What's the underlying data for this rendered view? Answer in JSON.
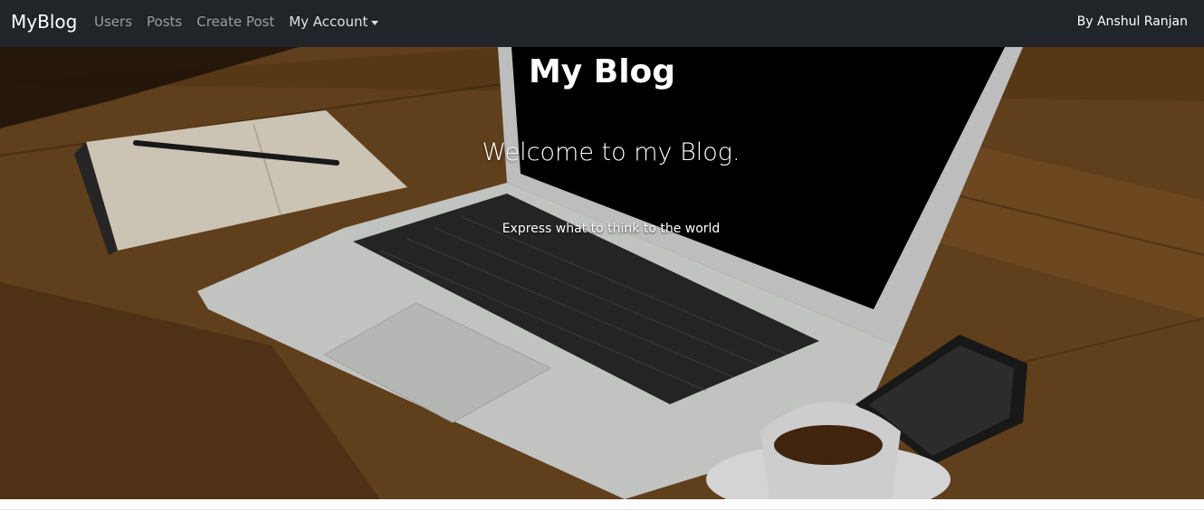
{
  "navbar": {
    "brand": "MyBlog",
    "links": [
      {
        "label": "Users"
      },
      {
        "label": "Posts"
      },
      {
        "label": "Create Post"
      },
      {
        "label": "My Account"
      }
    ],
    "author": "By Anshul Ranjan"
  },
  "hero": {
    "title": "My Blog",
    "subtitle": "Welcome to my Blog.",
    "tagline": "Express what to think to the world",
    "image_icon": "laptop-desk-photo"
  },
  "colors": {
    "navbar_bg": "#212529",
    "wood": "#7a4f22",
    "text": "#ffffff"
  }
}
